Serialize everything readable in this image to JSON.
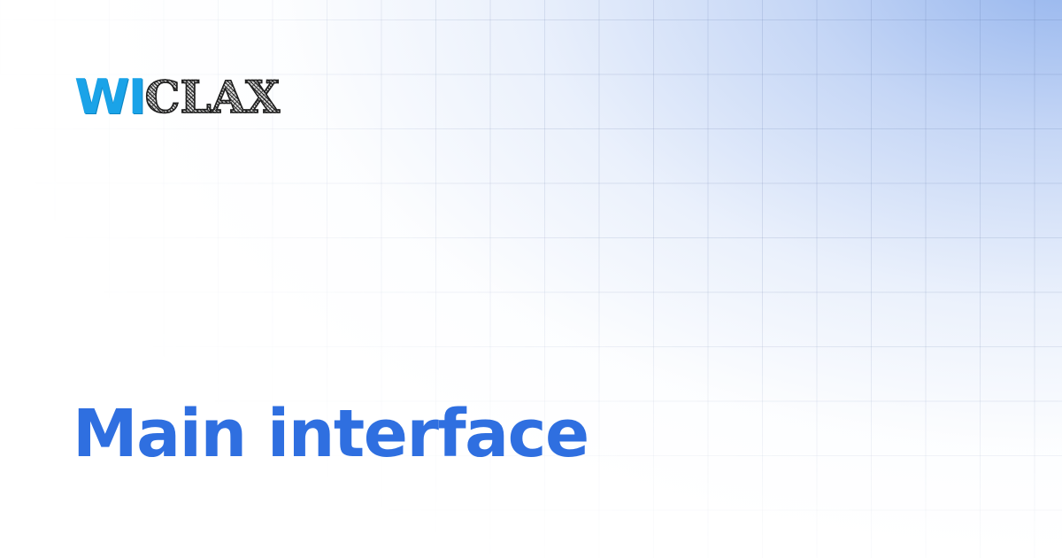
{
  "logo": {
    "part_1": "WI",
    "part_2": "CLAX"
  },
  "title": "Main interface",
  "colors": {
    "title": "#2f6fe0",
    "logo_accent": "#1aa3e8",
    "logo_dark": "#1e1e1e",
    "gradient": "#749ee8",
    "background": "#ffffff"
  }
}
